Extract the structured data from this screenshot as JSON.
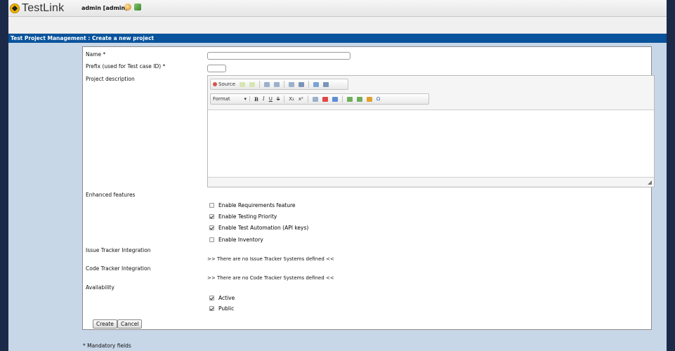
{
  "app": {
    "name": "TestLink",
    "user": "admin [admin]"
  },
  "title": "Test Project Management : Create a new project",
  "form": {
    "name_label": "Name *",
    "prefix_label": "Prefix (used for Test case ID) *",
    "description_label": "Project description",
    "toolbar": {
      "source_label": "Source",
      "format_label": "Format",
      "bold": "B",
      "italic": "I",
      "underline": "U",
      "strike": "S",
      "subscript": "X₂",
      "superscript": "x²",
      "omega": "Ω"
    },
    "enhanced_label": "Enhanced features",
    "features": [
      {
        "label": "Enable Requirements feature",
        "checked": false
      },
      {
        "label": "Enable Testing Priority",
        "checked": true
      },
      {
        "label": "Enable Test Automation (API keys)",
        "checked": true
      },
      {
        "label": "Enable Inventory",
        "checked": false
      }
    ],
    "issue_tracker_label": "Issue Tracker Integration",
    "issue_tracker_note": ">> There are no Issue Tracker Systems defined <<",
    "code_tracker_label": "Code Tracker Integration",
    "code_tracker_note": ">> There are no Code Tracker Systems defined <<",
    "availability_label": "Availability",
    "availability": [
      {
        "label": "Active",
        "checked": true
      },
      {
        "label": "Public",
        "checked": true
      }
    ],
    "create_button": "Create",
    "cancel_button": "Cancel"
  },
  "footer_note": "* Mandatory fields"
}
